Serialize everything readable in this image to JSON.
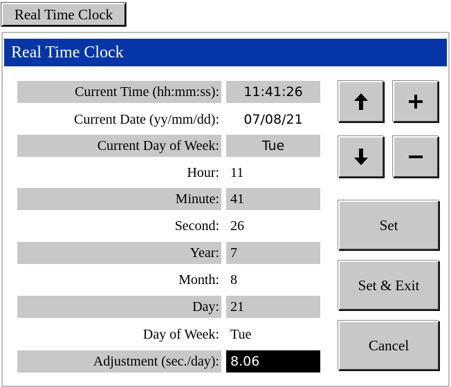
{
  "top_button": {
    "label": "Real Time Clock"
  },
  "window": {
    "title": "Real Time Clock"
  },
  "rows": [
    {
      "label": "Current Time (hh:mm:ss):",
      "value": "11:41:26"
    },
    {
      "label": "Current Date (yy/mm/dd):",
      "value": "07/08/21"
    },
    {
      "label": "Current Day of Week:",
      "value": "Tue"
    },
    {
      "label": "Hour:",
      "value": "11"
    },
    {
      "label": "Minute:",
      "value": "41"
    },
    {
      "label": "Second:",
      "value": "26"
    },
    {
      "label": "Year:",
      "value": "7"
    },
    {
      "label": "Month:",
      "value": "8"
    },
    {
      "label": "Day:",
      "value": "21"
    },
    {
      "label": "Day of Week:",
      "value": "Tue"
    },
    {
      "label": "Adjustment (sec./day):",
      "value": "8.06"
    }
  ],
  "buttons": {
    "up_icon": "arrow-up-icon",
    "plus_icon": "plus-icon",
    "down_icon": "arrow-down-icon",
    "minus_icon": "minus-icon",
    "set": "Set",
    "set_exit": "Set & Exit",
    "cancel": "Cancel"
  },
  "colors": {
    "title_bar": "#0635a8",
    "shaded_row": "#c8c8c8",
    "selected_field": "#000000"
  }
}
